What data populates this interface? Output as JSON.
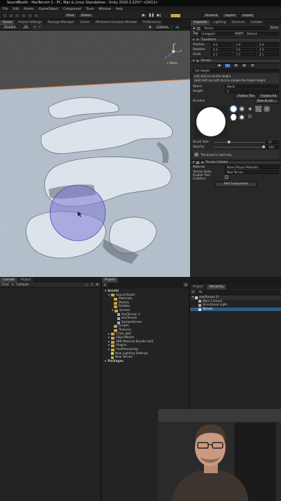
{
  "window_title": "SoundBooth - HasTerrain 1 - PC, Mac & Linux Standalone - Unity 2020.3.22f1* <DX11>",
  "menu": [
    "File",
    "Edit",
    "Assets",
    "GameObject",
    "Component",
    "Tools",
    "Window",
    "Help"
  ],
  "toolbar": {
    "pivot": "Pivot",
    "global": "Global",
    "account": "Account",
    "layers": "Layers",
    "layout": "Layout"
  },
  "scene_tabs": [
    "Scene",
    "Project Settings",
    "Package Manager",
    "Game",
    "Attributes Example Window",
    "Preferences"
  ],
  "scene_bar": {
    "shading": "Shaded",
    "mode": "2D",
    "gizmos": "Gizmos",
    "search": "All"
  },
  "gizmo": {
    "persp": "< Persp",
    "x": "x",
    "y": "y",
    "z": "z"
  },
  "inspector": {
    "tabs": [
      "Inspector",
      "Lighting",
      "Services",
      "Collabo"
    ],
    "object_name": "Terrain",
    "static_label": "Static",
    "tag_label": "Tag",
    "tag_value": "Untagged",
    "layer_label": "Layer",
    "layer_value": "Default",
    "transform": {
      "title": "Transform",
      "position_label": "Position",
      "rotation_label": "Rotation",
      "scale_label": "Scale",
      "position": {
        "x": "X 0",
        "y": "Y 0",
        "z": "Z 0"
      },
      "rotation": {
        "x": "X 0",
        "y": "Y 0",
        "z": "Z 0"
      },
      "scale": {
        "x": "X 1",
        "y": "Y 1",
        "z": "Z 1"
      }
    },
    "terrain": {
      "title": "Terrain",
      "tool": "Set Height",
      "help1": "Left click to set the height.",
      "help2": "Hold shift and left click to sample the target height.",
      "space_label": "Space",
      "space_value": "World",
      "height_label": "Height",
      "height_value": "0",
      "flatten_tile": "Flatten Tile",
      "flatten_all": "Flatten All",
      "brushes_label": "Brushes",
      "new_brush": "New Brush...",
      "brush_size_label": "Brush Size",
      "brush_size_value": "57",
      "opacity_label": "Opacity",
      "opacity_value": "100",
      "brush_size_fraction": 0.3,
      "opacity_fraction": 1.0,
      "brush_note": "The brush is read-only."
    },
    "collider": {
      "title": "Terrain Collider",
      "material_label": "Material",
      "material_value": "None (Physic Material)",
      "data_label": "Terrain Data",
      "data_value": "New Terrain",
      "trees_label": "Enable Tree Colliders"
    },
    "add_component": "Add Component"
  },
  "console": {
    "tabs": [
      "Console",
      "Project"
    ],
    "clear": "Clear",
    "collapse": "Collapse"
  },
  "project": {
    "tab": "Project",
    "tree": [
      {
        "label": "Assets",
        "depth": 0,
        "icon": "fold"
      },
      {
        "label": "Sound Booth",
        "depth": 1,
        "icon": "folder"
      },
      {
        "label": "Materials",
        "depth": 2,
        "icon": "folder"
      },
      {
        "label": "Models",
        "depth": 2,
        "icon": "folder"
      },
      {
        "label": "Prefabs",
        "depth": 2,
        "icon": "folder"
      },
      {
        "label": "Scenes",
        "depth": 2,
        "icon": "folder"
      },
      {
        "label": "HasTerrain 1",
        "depth": 3,
        "icon": "scene"
      },
      {
        "label": "HasTerrain",
        "depth": 3,
        "icon": "scene"
      },
      {
        "label": "SampleScene",
        "depth": 3,
        "icon": "scene"
      },
      {
        "label": "Scripts",
        "depth": 2,
        "icon": "folder"
      },
      {
        "label": "Textures",
        "depth": 2,
        "icon": "folder"
      },
      {
        "label": "CTAA_NXT",
        "depth": 1,
        "icon": "folder"
      },
      {
        "label": "ObjectNotes",
        "depth": 1,
        "icon": "folder"
      },
      {
        "label": "PBR Material Bundle Vol1",
        "depth": 1,
        "icon": "folder"
      },
      {
        "label": "Plugins",
        "depth": 1,
        "icon": "folder"
      },
      {
        "label": "PostProcessing",
        "depth": 1,
        "icon": "folder"
      },
      {
        "label": "New Lighting Settings",
        "depth": 1,
        "icon": "asset"
      },
      {
        "label": "New Terrain",
        "depth": 1,
        "icon": "asset"
      },
      {
        "label": "Packages",
        "depth": 0,
        "icon": "fold"
      }
    ]
  },
  "hierarchy": {
    "tabs": [
      "Project",
      "Hierarchy"
    ],
    "search": "All",
    "items": [
      {
        "label": "HasTerrain 1*",
        "depth": 0
      },
      {
        "label": "Main Camera",
        "depth": 1
      },
      {
        "label": "Directional Light",
        "depth": 1
      },
      {
        "label": "Terrain",
        "depth": 1
      }
    ]
  },
  "colors": {
    "accent": "#3a72c4",
    "selection": "#2c5d87",
    "brush_preview": "#7d7cd6"
  }
}
